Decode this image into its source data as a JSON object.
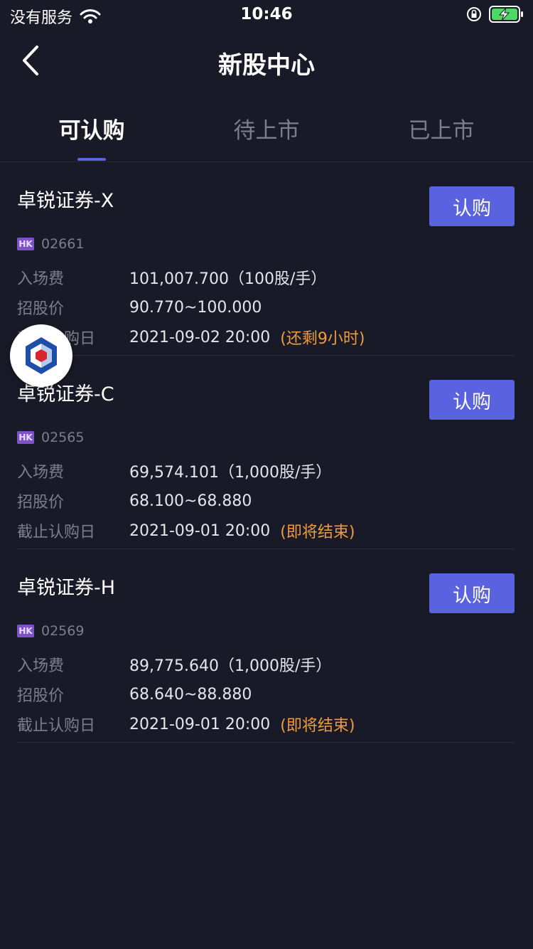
{
  "status_bar": {
    "carrier": "没有服务",
    "time": "10:46"
  },
  "nav": {
    "title": "新股中心"
  },
  "tabs": [
    {
      "label": "可认购",
      "active": true
    },
    {
      "label": "待上市",
      "active": false
    },
    {
      "label": "已上市",
      "active": false
    }
  ],
  "labels": {
    "fee": "入场费",
    "price": "招股价",
    "deadline": "截止认购日",
    "market": "HK"
  },
  "cards": [
    {
      "name": "卓锐证券-X",
      "button": "认购",
      "code": "02661",
      "fee": "101,007.700（100股/手）",
      "price": "90.770~100.000",
      "deadline": "2021-09-02 20:00",
      "note": "(还剩9小时)"
    },
    {
      "name": "卓锐证券-C",
      "button": "认购",
      "code": "02565",
      "fee": "69,574.101（1,000股/手）",
      "price": "68.100~68.880",
      "deadline": "2021-09-01 20:00",
      "note": "(即将结束)"
    },
    {
      "name": "卓锐证券-H",
      "button": "认购",
      "code": "02569",
      "fee": "89,775.640（1,000股/手）",
      "price": "68.640~88.880",
      "deadline": "2021-09-01 20:00",
      "note": "(即将结束)"
    }
  ],
  "colors": {
    "background": "#191a27",
    "accent": "#5b62e0",
    "warning": "#f09a3e",
    "badge": "#7d52c9"
  },
  "icons": {
    "back": "chevron-left-icon",
    "wifi": "wifi-icon",
    "lock": "orientation-lock-icon",
    "battery": "battery-charging-icon",
    "floating": "app-logo-icon"
  }
}
